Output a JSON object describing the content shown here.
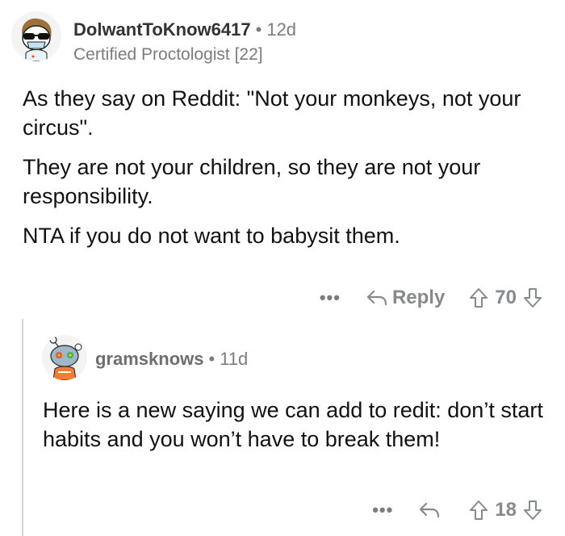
{
  "comments": [
    {
      "username": "DolwantToKnow6417",
      "separator": "•",
      "time": "12d",
      "flair": "Certified Proctologist [22]",
      "paragraphs": [
        "As they say on Reddit: \"Not your monkeys, not your circus\".",
        "They are not your children, so they are not your responsibility.",
        "NTA if you do not want to babysit them."
      ],
      "more_label": "•••",
      "reply_label": "Reply",
      "score": "70"
    },
    {
      "username": "gramsknows",
      "separator": "•",
      "time": "11d",
      "paragraphs": [
        "Here is a new saying we can add to redit: don’t start habits and you won’t have to break them!"
      ],
      "more_label": "•••",
      "score": "18"
    }
  ],
  "icons": {
    "reply": "reply-arrow-icon",
    "upvote": "upvote-arrow-icon",
    "downvote": "downvote-arrow-icon"
  },
  "colors": {
    "meta_gray": "#7c7c7c",
    "thread_line": "#d7d7d7"
  }
}
